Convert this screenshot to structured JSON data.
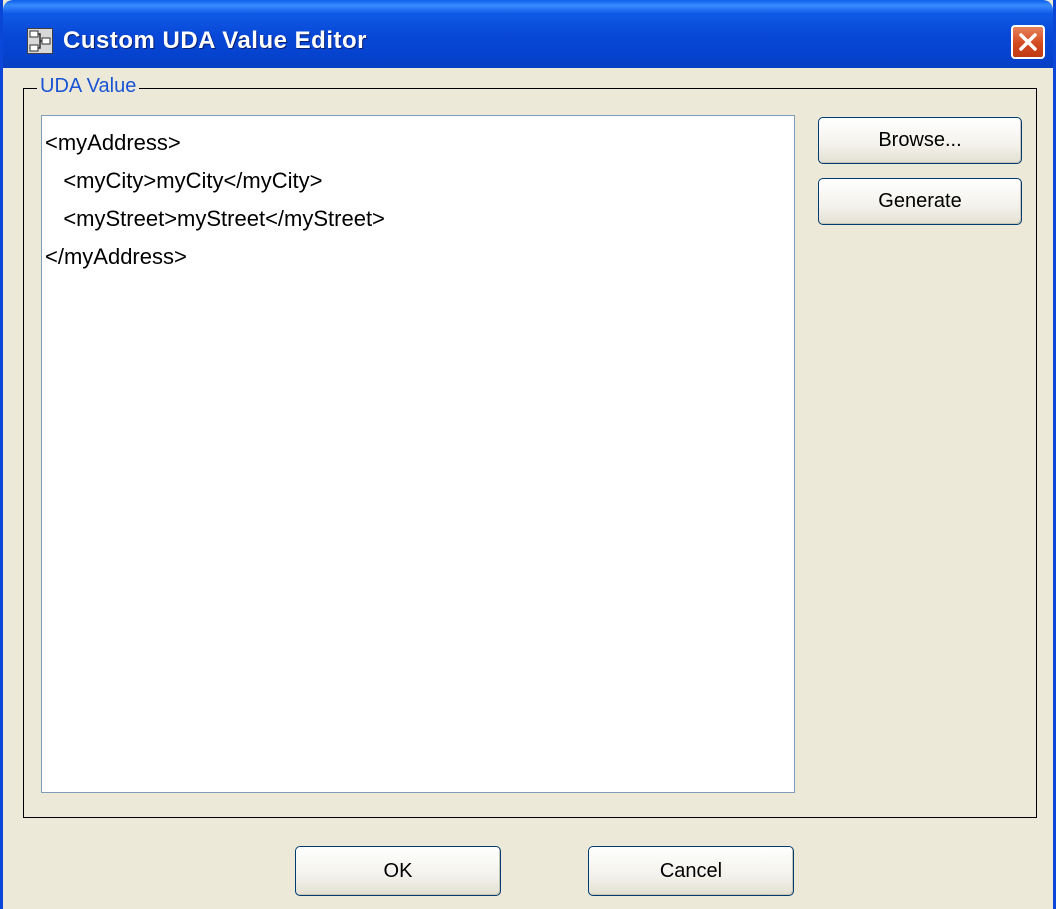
{
  "window": {
    "title": "Custom UDA Value Editor",
    "title_icon": "uda-editor-icon",
    "close_icon": "close-icon"
  },
  "group": {
    "legend": "UDA Value"
  },
  "editor": {
    "value": "<myAddress>\n   <myCity>myCity</myCity>\n   <myStreet>myStreet</myStreet>\n</myAddress>"
  },
  "side_buttons": {
    "browse_label": "Browse...",
    "generate_label": "Generate"
  },
  "footer": {
    "ok_label": "OK",
    "cancel_label": "Cancel"
  },
  "colors": {
    "titlebar": "#0846d6",
    "window_bg": "#ece9d8",
    "legend_text": "#1a54d4",
    "close_button": "#d44a1f"
  }
}
